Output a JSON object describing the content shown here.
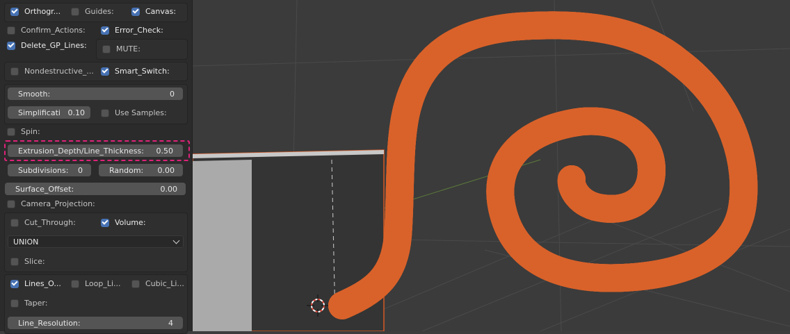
{
  "row1": {
    "ortho": {
      "label": "Orthogr...",
      "checked": true
    },
    "guides": {
      "label": "Guides:",
      "checked": false
    },
    "canvas": {
      "label": "Canvas:",
      "checked": true
    }
  },
  "row2": {
    "confirm": {
      "label": "Confirm_Actions:",
      "checked": false
    },
    "error": {
      "label": "Error_Check:",
      "checked": true
    }
  },
  "row3": {
    "delete": {
      "label": "Delete_GP_Lines:",
      "checked": true
    },
    "mute": {
      "label": "MUTE:",
      "checked": false
    }
  },
  "row4": {
    "nondestructive": {
      "label": "Nondestructive_...",
      "checked": false
    },
    "smart": {
      "label": "Smart_Switch:",
      "checked": true
    }
  },
  "smooth": {
    "label": "Smooth:",
    "value": "0"
  },
  "simplify": {
    "label": "Simplificati",
    "value": "0.10"
  },
  "use_samples": {
    "label": "Use Samples:",
    "checked": false
  },
  "spin": {
    "label": "Spin:",
    "checked": false
  },
  "extrusion": {
    "label": "Extrusion_Depth/Line_Thickness:",
    "value": "0.50"
  },
  "subdivisions": {
    "label": "Subdivisions:",
    "value": "0"
  },
  "random": {
    "label": "Random:",
    "value": "0.00"
  },
  "surface_offset": {
    "label": "Surface_Offset:",
    "value": "0.00"
  },
  "camera_projection": {
    "label": "Camera_Projection:",
    "checked": false
  },
  "cut_through": {
    "label": "Cut_Through:",
    "checked": false
  },
  "volume": {
    "label": "Volume:",
    "checked": true
  },
  "boolean_mode": {
    "value": "UNION"
  },
  "slice": {
    "label": "Slice:",
    "checked": false
  },
  "lines_o": {
    "label": "Lines_O...",
    "checked": true
  },
  "loop_li": {
    "label": "Loop_Li...",
    "checked": false
  },
  "cubic_li": {
    "label": "Cubic_Li...",
    "checked": false
  },
  "taper": {
    "label": "Taper:",
    "checked": false
  },
  "line_resolution": {
    "label": "Line_Resolution:",
    "value": "4"
  },
  "colors": {
    "panel_bg": "#2b2b2b",
    "accent": "#4772b3",
    "field": "#545454",
    "highlight": "#e0227a",
    "mesh": "#4aa3a3",
    "outline": "#e0662a",
    "viewport_bg": "#3b3b3b"
  },
  "icons": [
    "cursor-3d-icon"
  ]
}
